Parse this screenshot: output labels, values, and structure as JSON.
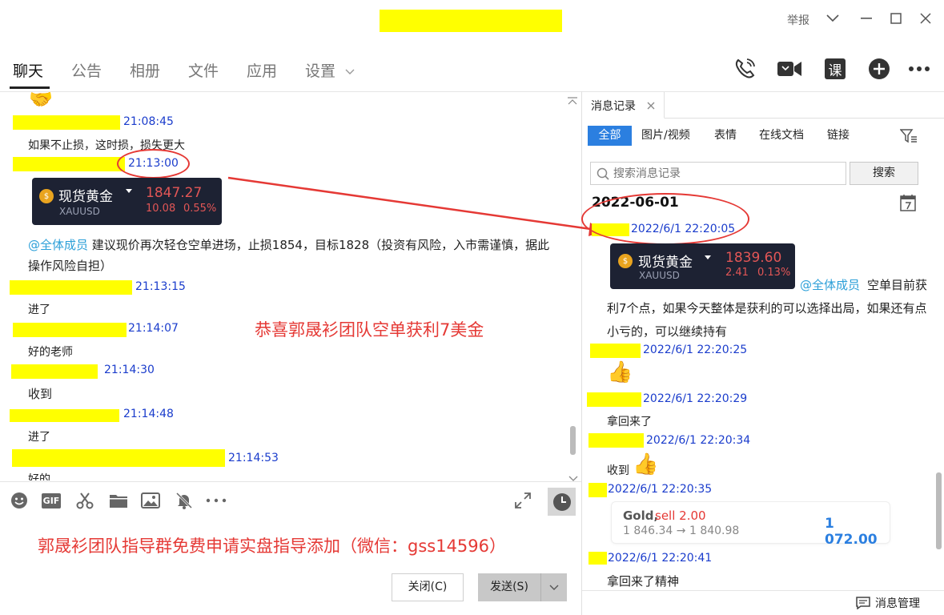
{
  "titlebar": {
    "report_label": "举报"
  },
  "tabs": [
    {
      "label": "聊天"
    },
    {
      "label": "公告"
    },
    {
      "label": "相册"
    },
    {
      "label": "文件"
    },
    {
      "label": "应用"
    },
    {
      "label": "设置"
    }
  ],
  "toolbar_icons": [
    "phone-icon",
    "video-call-icon",
    "course-icon",
    "add-icon",
    "more-icon"
  ],
  "toolbar": {
    "course_glyph": "课"
  },
  "chat": {
    "messages": [
      {
        "time": "21:08:45",
        "text": "如果不止损，这时损，损失更大"
      },
      {
        "time": "21:13:00"
      },
      {
        "mention": "@全体成员",
        "text": "建议现价再次轻仓空单进场，止损1854，目标1828（投资有风险，入市需谨慎，据此操作风险自担）"
      },
      {
        "time": "21:13:15",
        "text": "进了"
      },
      {
        "time": "21:14:07",
        "text": "好的老师"
      },
      {
        "time": "21:14:30",
        "text": "收到"
      },
      {
        "time": "21:14:48",
        "text": "进了"
      },
      {
        "time": "21:14:53",
        "text": "好的"
      }
    ],
    "card": {
      "title": "现货黄金",
      "symbol": "XAUUSD",
      "price": "1847.27",
      "change": "10.08",
      "pct": "0.55%"
    },
    "overlay_text": "恭喜郭晟衫团队空单获利7美金"
  },
  "input": {
    "promo_text": "郭晟衫团队指导群免费申请实盘指导添加（微信：gss14596）",
    "close_label": "关闭(C)",
    "send_label": "发送(S)"
  },
  "history": {
    "panel_title": "消息记录",
    "filters": [
      "全部",
      "图片/视频",
      "表情",
      "在线文档",
      "链接"
    ],
    "search_placeholder": "搜索消息记录",
    "search_button": "搜索",
    "date_header": "2022-06-01",
    "card": {
      "title": "现货黄金",
      "symbol": "XAUUSD",
      "price": "1839.60",
      "change": "2.41",
      "pct": "0.13%"
    },
    "messages": [
      {
        "time": "2022/6/1 22:20:05",
        "mention": "@全体成员",
        "text": "空单目前获利7个点，如果今天整体是获利的可以选择出局，如果还有点小亏的，可以继续持有"
      },
      {
        "time": "2022/6/1 22:20:25"
      },
      {
        "time": "2022/6/1 22:20:29",
        "text": "拿回来了"
      },
      {
        "time": "2022/6/1 22:20:34",
        "text": "收到"
      },
      {
        "time": "2022/6/1 22:20:35"
      },
      {
        "time": "2022/6/1 22:20:41",
        "text": "拿回来了精神"
      }
    ],
    "trade": {
      "symbol": "Gold,",
      "side": "sell 2.00",
      "prices": "1 846.34 → 1 840.98",
      "profit": "1 072.00"
    },
    "footer_label": "消息管理"
  },
  "colors": {
    "highlight": "#ffff00",
    "timestamp": "#1a3ccc",
    "annotation_red": "#e53935",
    "mention": "#2b9fd8",
    "accent_blue": "#2b7fe0",
    "card_bg": "#1d2233",
    "price_red": "#e25656"
  }
}
